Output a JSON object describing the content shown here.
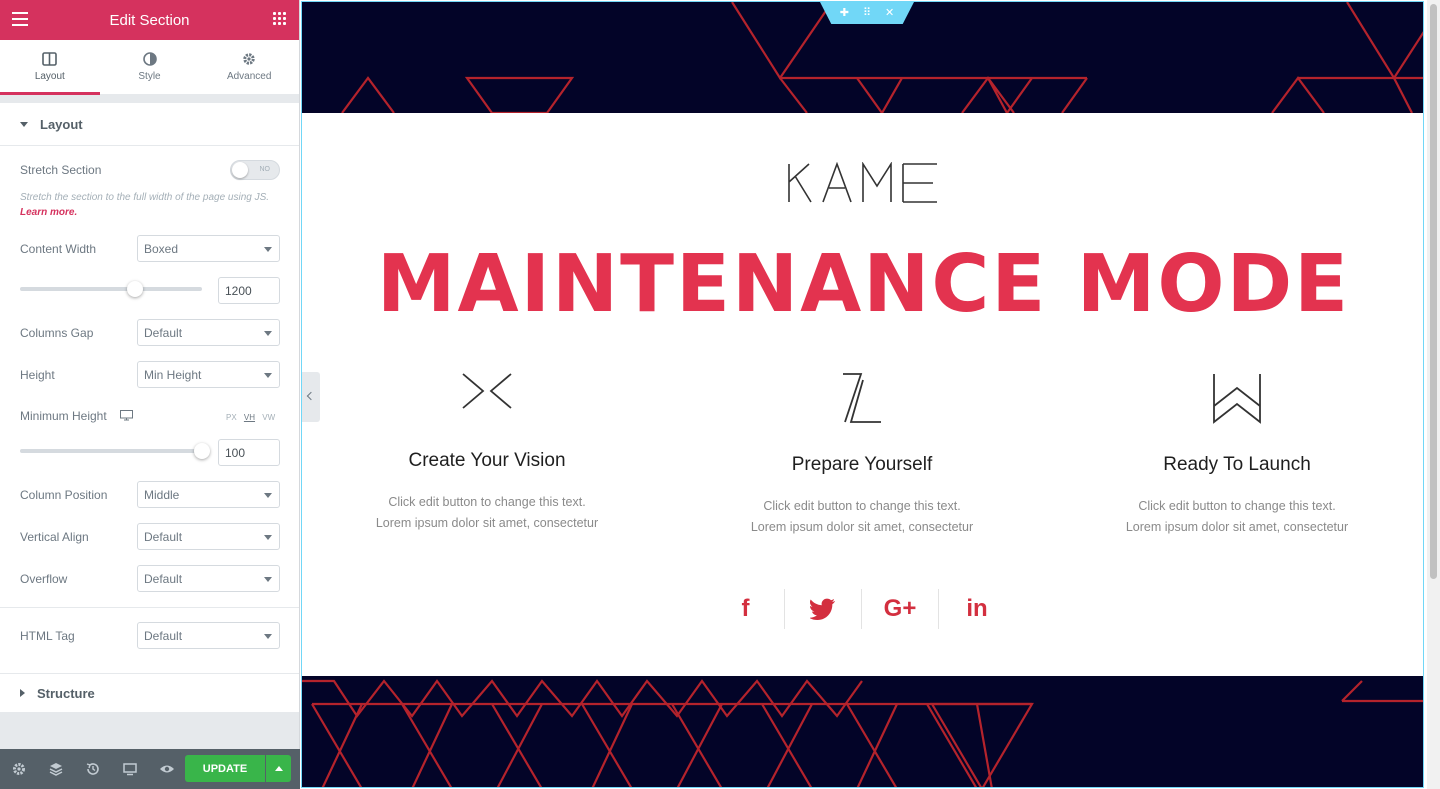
{
  "editor": {
    "title": "Edit Section",
    "tabs": [
      {
        "label": "Layout",
        "icon": "columns-icon"
      },
      {
        "label": "Style",
        "icon": "contrast-icon"
      },
      {
        "label": "Advanced",
        "icon": "gear-icon"
      }
    ],
    "layout_section": "Layout",
    "stretch_section": {
      "label": "Stretch Section",
      "toggle_text": "NO",
      "help": "Stretch the section to the full width of the page using JS.",
      "help_link": "Learn more."
    },
    "content_width": {
      "label": "Content Width",
      "value": "Boxed",
      "number": "1200",
      "slider_fraction": 0.63
    },
    "columns_gap": {
      "label": "Columns Gap",
      "value": "Default"
    },
    "height": {
      "label": "Height",
      "value": "Min Height"
    },
    "minimum_height": {
      "label": "Minimum Height",
      "units": [
        "PX",
        "VH",
        "VW"
      ],
      "active_unit": "VH",
      "number": "100",
      "slider_fraction": 1.0
    },
    "column_position": {
      "label": "Column Position",
      "value": "Middle"
    },
    "vertical_align": {
      "label": "Vertical Align",
      "value": "Default"
    },
    "overflow": {
      "label": "Overflow",
      "value": "Default"
    },
    "html_tag": {
      "label": "HTML Tag",
      "value": "Default"
    },
    "structure_section": "Structure",
    "footer": {
      "update_label": "UPDATE"
    }
  },
  "preview": {
    "headline": "MAINTENANCE MODE",
    "features": [
      {
        "title": "Create Your Vision",
        "line1": "Click edit button to change this text.",
        "line2": "Lorem ipsum dolor sit amet, consectetur"
      },
      {
        "title": "Prepare Yourself",
        "line1": "Click edit button to change this text.",
        "line2": "Lorem ipsum dolor sit amet, consectetur"
      },
      {
        "title": "Ready To Launch",
        "line1": "Click edit button to change this text.",
        "line2": "Lorem ipsum dolor sit amet, consectetur"
      }
    ],
    "socials": [
      "f",
      "twitter-icon",
      "G+",
      "in"
    ],
    "colors": {
      "accent": "#e3334f",
      "navy": "#030428",
      "editor_pink": "#d5325e",
      "update_green": "#39b54a"
    }
  }
}
